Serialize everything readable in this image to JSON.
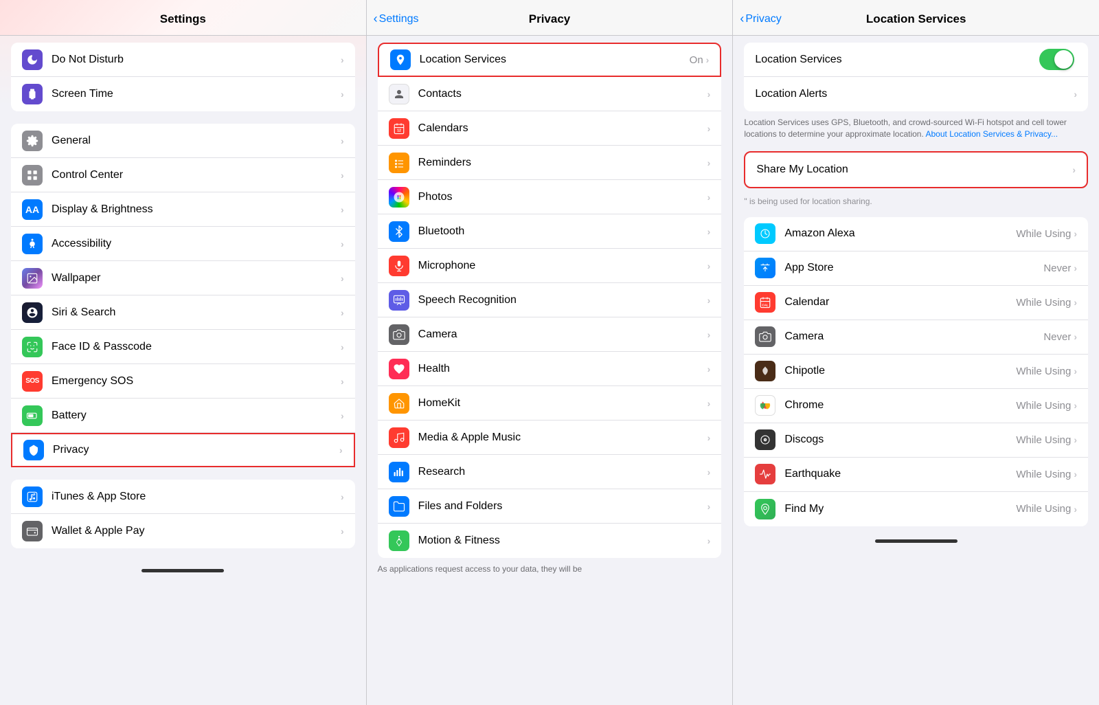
{
  "panel1": {
    "title": "Settings",
    "groups": [
      {
        "items": [
          {
            "id": "do-not-disturb",
            "icon_bg": "ic-indigo",
            "icon": "moon",
            "label": "Do Not Disturb"
          },
          {
            "id": "screen-time",
            "icon_bg": "ic-indigo",
            "icon": "hourglass",
            "label": "Screen Time"
          }
        ]
      },
      {
        "items": [
          {
            "id": "general",
            "icon_bg": "ic-gray",
            "icon": "gear",
            "label": "General"
          },
          {
            "id": "control-center",
            "icon_bg": "ic-gray",
            "icon": "sliders",
            "label": "Control Center"
          },
          {
            "id": "display-brightness",
            "icon_bg": "ic-blue",
            "icon": "aa",
            "label": "Display & Brightness"
          },
          {
            "id": "accessibility",
            "icon_bg": "ic-blue",
            "icon": "accessibility",
            "label": "Accessibility"
          },
          {
            "id": "wallpaper",
            "icon_bg": "ic-teal",
            "icon": "wallpaper",
            "label": "Wallpaper"
          },
          {
            "id": "siri-search",
            "icon_bg": "ic-dark-gray",
            "icon": "siri",
            "label": "Siri & Search"
          },
          {
            "id": "face-id",
            "icon_bg": "ic-green",
            "icon": "faceid",
            "label": "Face ID & Passcode"
          },
          {
            "id": "emergency-sos",
            "icon_bg": "ic-sos",
            "icon": "sos",
            "label": "Emergency SOS"
          },
          {
            "id": "battery",
            "icon_bg": "ic-green",
            "icon": "battery",
            "label": "Battery"
          },
          {
            "id": "privacy",
            "icon_bg": "ic-blue",
            "icon": "hand",
            "label": "Privacy",
            "highlighted": true
          }
        ]
      },
      {
        "items": [
          {
            "id": "itunes-app-store",
            "icon_bg": "ic-blue",
            "icon": "itunes",
            "label": "iTunes & App Store"
          },
          {
            "id": "wallet-apple-pay",
            "icon_bg": "ic-dark-gray",
            "icon": "wallet",
            "label": "Wallet & Apple Pay"
          }
        ]
      }
    ]
  },
  "panel2": {
    "title": "Privacy",
    "back_label": "Settings",
    "items": [
      {
        "id": "location-services",
        "icon_bg": "ic-blue",
        "icon": "location",
        "label": "Location Services",
        "value": "On",
        "highlighted": true
      },
      {
        "id": "contacts",
        "icon_bg": "ic-gray",
        "icon": "contacts",
        "label": "Contacts"
      },
      {
        "id": "calendars",
        "icon_bg": "ic-red",
        "icon": "calendars",
        "label": "Calendars"
      },
      {
        "id": "reminders",
        "icon_bg": "ic-orange",
        "icon": "reminders",
        "label": "Reminders"
      },
      {
        "id": "photos",
        "icon_bg": "ic-multicolor",
        "icon": "photos",
        "label": "Photos"
      },
      {
        "id": "bluetooth",
        "icon_bg": "ic-blue",
        "icon": "bluetooth",
        "label": "Bluetooth"
      },
      {
        "id": "microphone",
        "icon_bg": "ic-red",
        "icon": "microphone",
        "label": "Microphone"
      },
      {
        "id": "speech-recognition",
        "icon_bg": "ic-purple",
        "icon": "speech",
        "label": "Speech Recognition"
      },
      {
        "id": "camera",
        "icon_bg": "ic-dark-gray",
        "icon": "camera",
        "label": "Camera"
      },
      {
        "id": "health",
        "icon_bg": "ic-pink",
        "icon": "health",
        "label": "Health"
      },
      {
        "id": "homekit",
        "icon_bg": "ic-orange",
        "icon": "homekit",
        "label": "HomeKit"
      },
      {
        "id": "media-apple-music",
        "icon_bg": "ic-red",
        "icon": "music",
        "label": "Media & Apple Music"
      },
      {
        "id": "research",
        "icon_bg": "ic-blue",
        "icon": "research",
        "label": "Research"
      },
      {
        "id": "files-folders",
        "icon_bg": "ic-blue",
        "icon": "files",
        "label": "Files and Folders"
      },
      {
        "id": "motion-fitness",
        "icon_bg": "ic-green",
        "icon": "motion",
        "label": "Motion & Fitness"
      }
    ],
    "footer": "As applications request access to your data, they will be"
  },
  "panel3": {
    "title": "Location Services",
    "back_label": "Privacy",
    "location_services_label": "Location Services",
    "location_alerts_label": "Location Alerts",
    "toggle_on": true,
    "desc": "Location Services uses GPS, Bluetooth, and crowd-sourced Wi-Fi hotspot and cell tower locations to determine your approximate location.",
    "desc_link": "About Location Services & Privacy...",
    "share_my_location_label": "Share My Location",
    "sharing_note": "\" is being used for location sharing.",
    "apps": [
      {
        "id": "amazon-alexa",
        "label": "Amazon Alexa",
        "value": "While Using",
        "icon_bg": "ic-teal",
        "icon": "alexa"
      },
      {
        "id": "app-store",
        "label": "App Store",
        "value": "Never",
        "icon_bg": "ic-blue",
        "icon": "appstore"
      },
      {
        "id": "calendar",
        "label": "Calendar",
        "value": "While Using",
        "icon_bg": "ic-red",
        "icon": "calendar"
      },
      {
        "id": "camera",
        "label": "Camera",
        "value": "Never",
        "icon_bg": "ic-dark-gray",
        "icon": "camera"
      },
      {
        "id": "chipotle",
        "label": "Chipotle",
        "value": "While Using",
        "icon_bg": "ic-dark-gray",
        "icon": "chipotle"
      },
      {
        "id": "chrome",
        "label": "Chrome",
        "value": "While Using",
        "icon_bg": "ic-blue",
        "icon": "chrome"
      },
      {
        "id": "discogs",
        "label": "Discogs",
        "value": "While Using",
        "icon_bg": "ic-dark-gray",
        "icon": "discogs"
      },
      {
        "id": "earthquake",
        "label": "Earthquake",
        "value": "While Using",
        "icon_bg": "ic-red",
        "icon": "earthquake"
      },
      {
        "id": "find-my",
        "label": "Find My",
        "value": "While Using",
        "icon_bg": "ic-green",
        "icon": "findmy"
      }
    ]
  }
}
